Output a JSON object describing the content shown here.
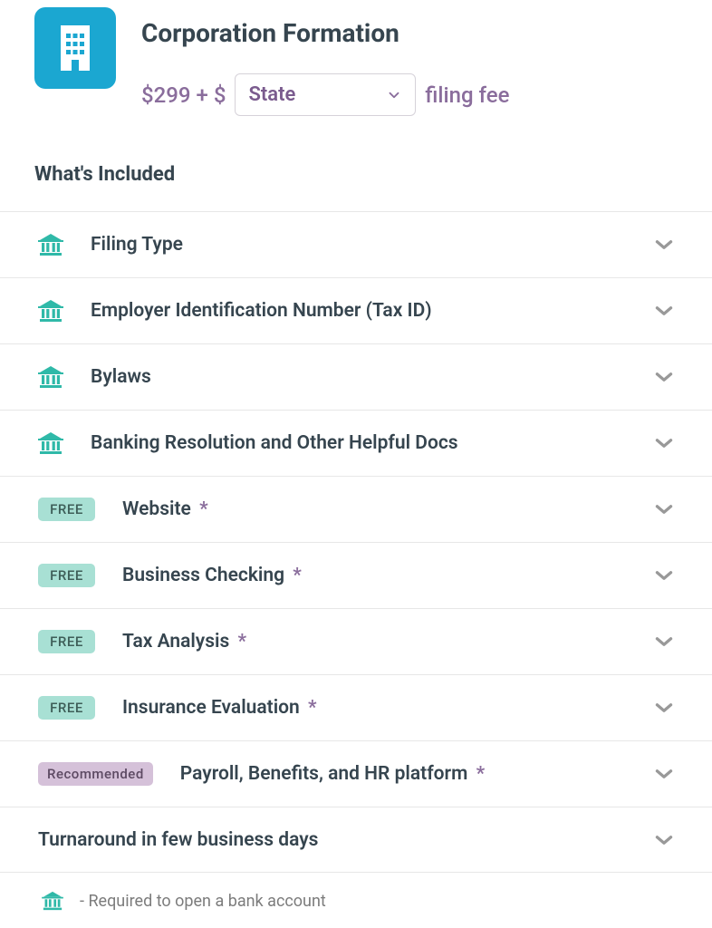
{
  "header": {
    "title": "Corporation Formation",
    "price_prefix": "$299 + $",
    "state_placeholder": "State",
    "filing_fee_label": "filing fee"
  },
  "section_title": "What's Included",
  "rows": [
    {
      "type": "bank",
      "label": "Filing Type",
      "asterisk": false
    },
    {
      "type": "bank",
      "label": "Employer Identification Number (Tax ID)",
      "asterisk": false
    },
    {
      "type": "bank",
      "label": "Bylaws",
      "asterisk": false
    },
    {
      "type": "bank",
      "label": "Banking Resolution and Other Helpful Docs",
      "asterisk": false
    },
    {
      "type": "free",
      "badge": "FREE",
      "label": "Website",
      "asterisk": true
    },
    {
      "type": "free",
      "badge": "FREE",
      "label": "Business Checking",
      "asterisk": true
    },
    {
      "type": "free",
      "badge": "FREE",
      "label": "Tax Analysis",
      "asterisk": true
    },
    {
      "type": "free",
      "badge": "FREE",
      "label": "Insurance Evaluation",
      "asterisk": true
    },
    {
      "type": "recommended",
      "badge": "Recommended",
      "label": "Payroll, Benefits, and HR platform",
      "asterisk": true
    },
    {
      "type": "plain",
      "label": "Turnaround in few business days",
      "asterisk": false
    }
  ],
  "legend": {
    "text": "- Required to open a bank account"
  }
}
